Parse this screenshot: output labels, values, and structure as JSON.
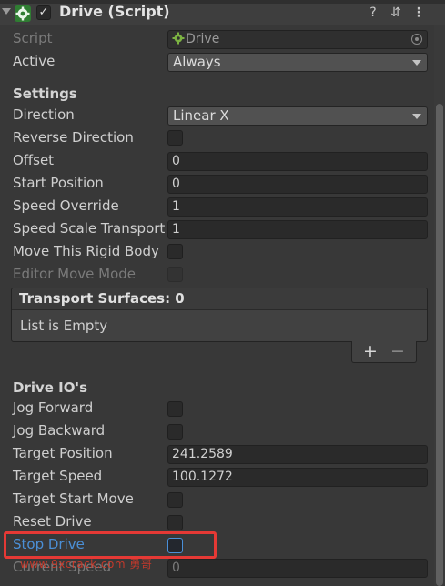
{
  "header": {
    "title": "Drive (Script)",
    "enabled_check": "✓",
    "help_icon": "?",
    "preset_icon": "⇵",
    "menu_icon": "⋮"
  },
  "fields": {
    "script": {
      "label": "Script",
      "value": "Drive"
    },
    "active": {
      "label": "Active",
      "value": "Always"
    },
    "settings_heading": "Settings",
    "direction": {
      "label": "Direction",
      "value": "Linear X"
    },
    "reverse_direction": {
      "label": "Reverse Direction",
      "checked": false
    },
    "offset": {
      "label": "Offset",
      "value": "0"
    },
    "start_position": {
      "label": "Start Position",
      "value": "0"
    },
    "speed_override": {
      "label": "Speed Override",
      "value": "1"
    },
    "speed_scale_transport": {
      "label": "Speed Scale Transport",
      "value": "1"
    },
    "move_rigid_body": {
      "label": "Move This Rigid Body",
      "checked": false
    },
    "editor_move_mode": {
      "label": "Editor Move Mode",
      "checked": false
    }
  },
  "transport_surfaces": {
    "title": "Transport Surfaces: 0",
    "empty_text": "List is Empty",
    "add_label": "+",
    "remove_label": "−"
  },
  "drive_io": {
    "heading": "Drive IO's",
    "jog_forward": {
      "label": "Jog Forward",
      "checked": false
    },
    "jog_backward": {
      "label": "Jog Backward",
      "checked": false
    },
    "target_position": {
      "label": "Target Position",
      "value": "241.2589"
    },
    "target_speed": {
      "label": "Target Speed",
      "value": "100.1272"
    },
    "target_start_move": {
      "label": "Target Start Move",
      "checked": false
    },
    "reset_drive": {
      "label": "Reset Drive",
      "checked": false
    },
    "stop_drive": {
      "label": "Stop Drive",
      "checked": false
    },
    "current_speed": {
      "label": "Current Speed",
      "value": "0"
    }
  },
  "watermark": "www.9xcrack.com 勇哥",
  "colors": {
    "highlight": "#e53935",
    "focus_label": "#4b8fd6",
    "panel_bg": "#383838"
  }
}
